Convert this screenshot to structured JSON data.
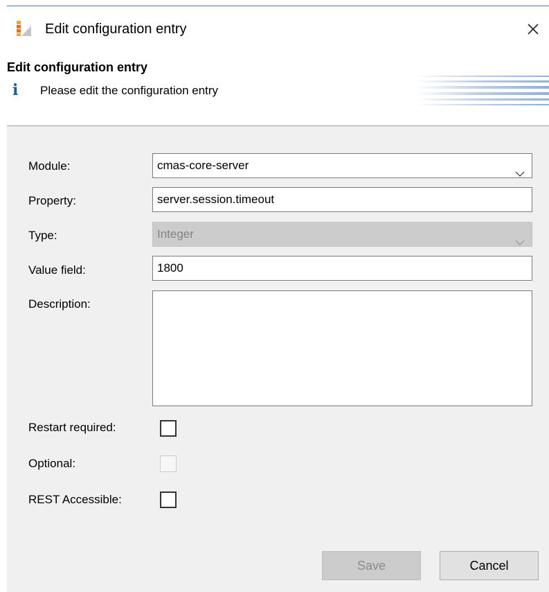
{
  "window": {
    "title": "Edit configuration entry",
    "close_icon": "close-icon",
    "app_icon": "app-logo-icon"
  },
  "banner": {
    "heading": "Edit configuration entry",
    "info_icon_glyph": "i",
    "message": "Please edit the configuration entry"
  },
  "form": {
    "module": {
      "label": "Module:",
      "value": "cmas-core-server"
    },
    "property": {
      "label": "Property:",
      "value": "server.session.timeout"
    },
    "type": {
      "label": "Type:",
      "value": "Integer",
      "disabled": true
    },
    "value_field": {
      "label": "Value field:",
      "value": "1800"
    },
    "description": {
      "label": "Description:",
      "value": ""
    },
    "restart_required": {
      "label": "Restart required:",
      "checked": false
    },
    "optional": {
      "label": "Optional:",
      "checked": false,
      "disabled": true
    },
    "rest_accessible": {
      "label": "REST Accessible:",
      "checked": false
    }
  },
  "buttons": {
    "save": {
      "label": "Save",
      "disabled": true
    },
    "cancel": {
      "label": "Cancel"
    }
  },
  "colors": {
    "accent": "#2b7cd3",
    "content_bg": "#f0f0f0",
    "info_icon": "#1c5aa8",
    "logo_orange": "#e8711c"
  }
}
